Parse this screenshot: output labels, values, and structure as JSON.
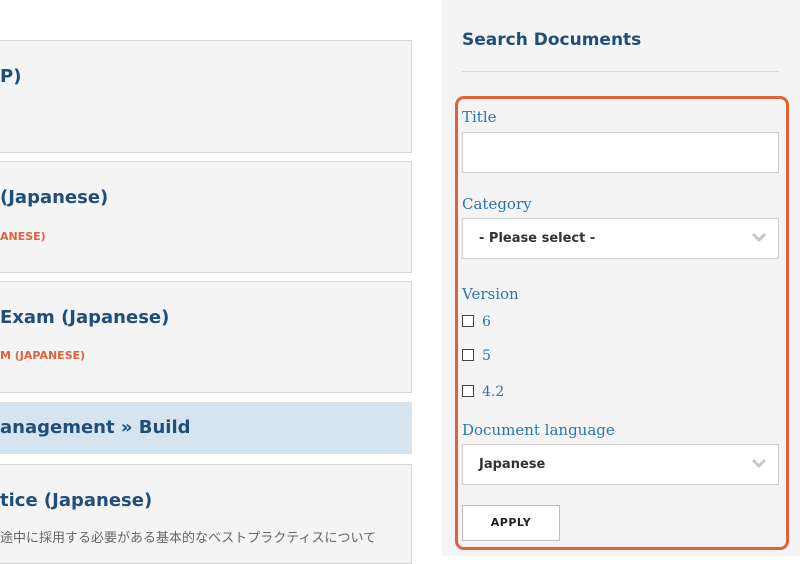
{
  "results": {
    "cards": [
      {
        "title": "P)",
        "subtitle": "",
        "description": ""
      },
      {
        "title": "(Japanese)",
        "subtitle": "ANESE)",
        "description": ""
      },
      {
        "title": "Exam (Japanese)",
        "subtitle": "M (JAPANESE)",
        "description": ""
      },
      {
        "title": "tice (Japanese)",
        "subtitle": "",
        "description": "途中に採用する必要がある基本的なベストプラクティスについて"
      }
    ],
    "breadcrumb": "anagement » Build"
  },
  "sidebar": {
    "heading": "Search Documents",
    "title_label": "Title",
    "title_value": "",
    "category_label": "Category",
    "category_selected": "- Please select -",
    "version_label": "Version",
    "versions": [
      "6",
      "5",
      "4.2"
    ],
    "language_label": "Document language",
    "language_selected": "Japanese",
    "apply_label": "APPLY"
  },
  "colors": {
    "accent": "#e0613c",
    "title": "#1f4e79",
    "label": "#2a77b0",
    "panel": "#f4f4f4",
    "highlight": "#d6e4f0"
  }
}
